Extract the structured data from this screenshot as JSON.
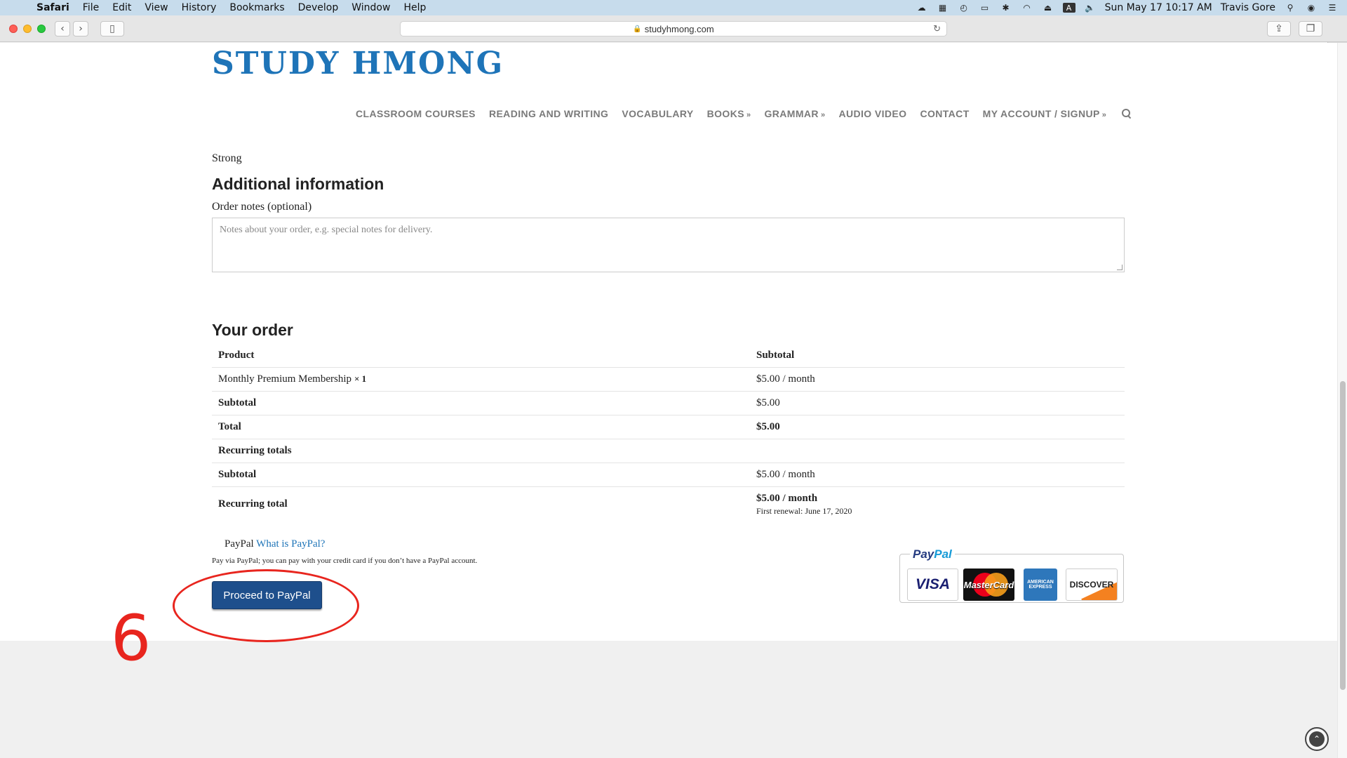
{
  "menubar": {
    "apple_icon": "apple-icon",
    "items": [
      "Safari",
      "File",
      "Edit",
      "View",
      "History",
      "Bookmarks",
      "Develop",
      "Window",
      "Help"
    ],
    "status_icons": [
      "cloud-icon",
      "grid-icon",
      "time-machine-icon",
      "airplay-icon",
      "bluetooth-icon",
      "wifi-icon",
      "eject-icon",
      "input-source-icon",
      "volume-icon"
    ],
    "input_source_letter": "A",
    "datetime": "Sun May 17  10:17 AM",
    "user": "Travis Gore"
  },
  "browser": {
    "url": "studyhmong.com"
  },
  "site": {
    "logo": "STUDY HMONG",
    "nav": [
      {
        "label": "CLASSROOM COURSES",
        "dropdown": false
      },
      {
        "label": "READING AND WRITING",
        "dropdown": false
      },
      {
        "label": "VOCABULARY",
        "dropdown": false
      },
      {
        "label": "BOOKS",
        "dropdown": true
      },
      {
        "label": "GRAMMAR",
        "dropdown": true
      },
      {
        "label": "AUDIO VIDEO",
        "dropdown": false
      },
      {
        "label": "CONTACT",
        "dropdown": false
      },
      {
        "label": "MY ACCOUNT / SIGNUP",
        "dropdown": true
      }
    ]
  },
  "checkout": {
    "password_strength": "Strong",
    "additional_heading": "Additional information",
    "notes_label": "Order notes (optional)",
    "notes_placeholder": "Notes about your order, e.g. special notes for delivery.",
    "order_heading": "Your order",
    "order_table": {
      "headers": [
        "Product",
        "Subtotal"
      ],
      "product": "Monthly Premium Membership",
      "qty": "× 1",
      "product_price": "$5.00 / month",
      "subtotal_label": "Subtotal",
      "subtotal_value": "$5.00",
      "total_label": "Total",
      "total_value": "$5.00",
      "recurring_label": "Recurring totals",
      "rec_subtotal_label": "Subtotal",
      "rec_subtotal_value": "$5.00 / month",
      "rec_total_label": "Recurring total",
      "rec_total_value": "$5.00 / month",
      "first_renewal": "First renewal: June 17, 2020"
    },
    "payment": {
      "method": "PayPal",
      "what_link": "What is PayPal?",
      "description": "Pay via PayPal; you can pay with your credit card if you don’t have a PayPal account.",
      "proceed_button": "Proceed to PayPal",
      "badge_logo_pay": "Pay",
      "badge_logo_pal": "Pal",
      "cards": [
        "VISA",
        "MasterCard",
        "AMERICAN EXPRESS",
        "DISCOVER"
      ]
    }
  },
  "annotation": {
    "step_number": "6",
    "color": "#e8251e"
  }
}
